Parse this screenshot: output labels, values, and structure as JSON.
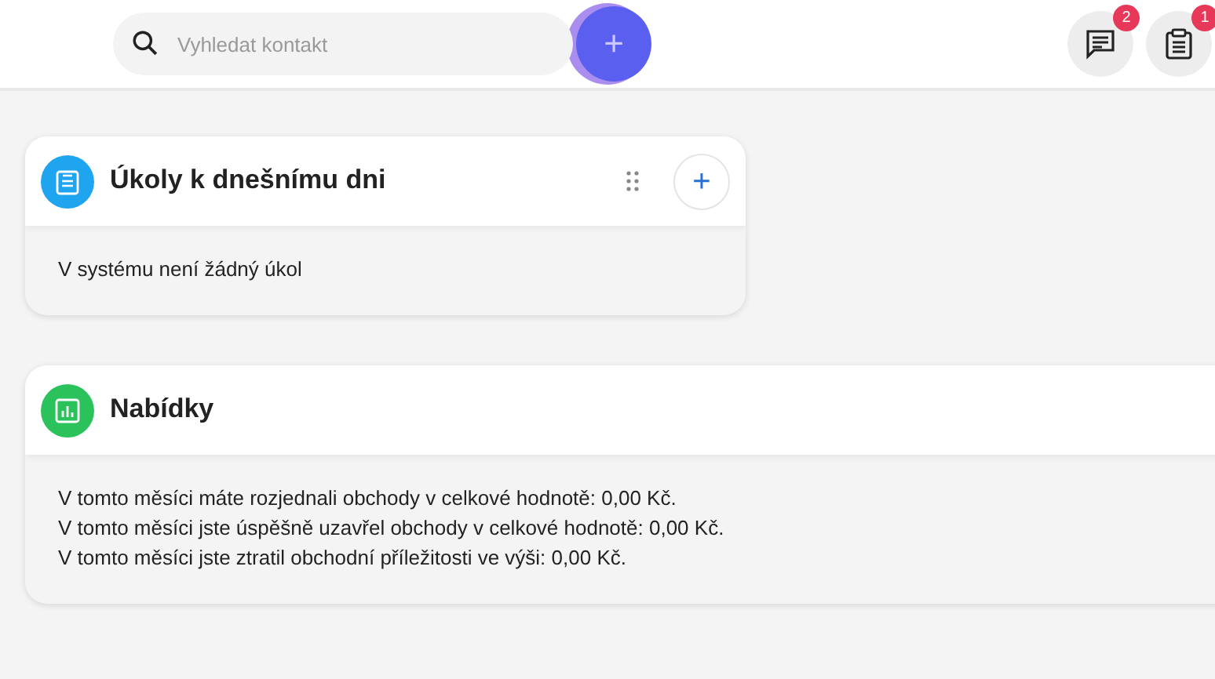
{
  "search": {
    "placeholder": "Vyhledat kontakt"
  },
  "add_button": {
    "label": "+"
  },
  "header_actions": [
    {
      "kind": "messages",
      "badge": "2"
    },
    {
      "kind": "tasks",
      "badge": "1"
    }
  ],
  "cards": [
    {
      "kind": "tasks",
      "title": "Úkoly k dnešnímu dni",
      "color": "#1fa5f0",
      "lines": [
        "V systému není žádný úkol"
      ],
      "actions": true
    },
    {
      "kind": "offers",
      "title": "Nabídky",
      "color": "#2bc25c",
      "lines": [
        "V tomto měsíci máte rozjednali obchody v celkové hodnotě: 0,00 Kč.",
        "V tomto měsíci jste úspěšně uzavřel obchody v celkové hodnotě: 0,00 Kč.",
        "V tomto měsíci jste ztratil obchodní příležitosti ve výši: 0,00 Kč."
      ],
      "actions": false
    }
  ]
}
